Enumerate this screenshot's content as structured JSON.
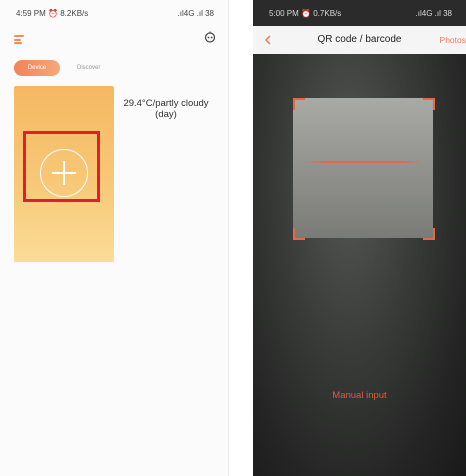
{
  "left_screen": {
    "status": {
      "time": "4:59 PM",
      "speed": "8.2KB/s",
      "network": "4G",
      "battery": "38"
    },
    "tabs": [
      {
        "label": "Device",
        "active": true
      },
      {
        "label": "Discover",
        "active": false
      }
    ],
    "weather": {
      "text": "29.4°C/partly cloudy\n(day)"
    }
  },
  "right_screen": {
    "status": {
      "time": "5:00 PM",
      "speed": "0.7KB/s",
      "network": "4G",
      "battery": "38"
    },
    "header": {
      "title": "QR code / barcode",
      "photos_label": "Photos"
    },
    "manual_input_label": "Manual input"
  },
  "colors": {
    "accent": "#f28d5a",
    "highlight": "#e3202a",
    "scan": "#e8683e"
  }
}
